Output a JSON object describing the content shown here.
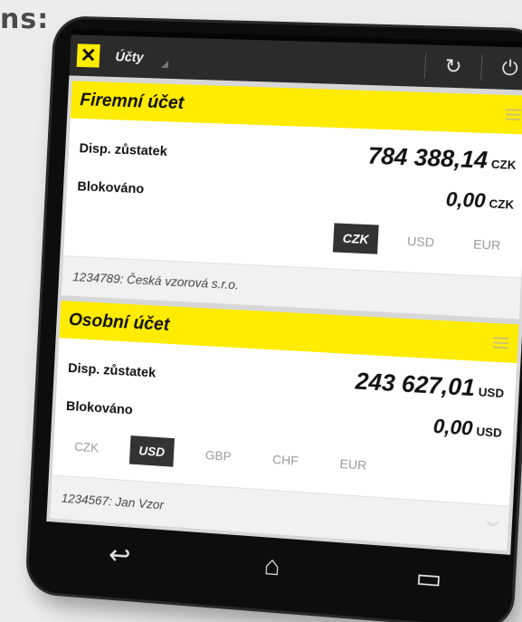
{
  "corner_text": "ns:",
  "app": {
    "title": "Účty"
  },
  "icons": {
    "logo": "raiffeisen-x-logo",
    "refresh": "refresh-icon",
    "power": "power-icon",
    "menu": "menu-icon"
  },
  "colors": {
    "accent": "#ffec00",
    "appbar": "#2b2b2b",
    "active_tab": "#333333"
  },
  "accounts": [
    {
      "title": "Firemní účet",
      "balance_label": "Disp. zůstatek",
      "balance": "784 388,14",
      "balance_currency": "CZK",
      "blocked_label": "Blokováno",
      "blocked": "0,00",
      "blocked_currency": "CZK",
      "currencies": [
        "CZK",
        "USD",
        "EUR"
      ],
      "selected_currency": "CZK",
      "footer": "1234789: Česká vzorová s.r.o."
    },
    {
      "title": "Osobní účet",
      "balance_label": "Disp. zůstatek",
      "balance": "243 627,01",
      "balance_currency": "USD",
      "blocked_label": "Blokováno",
      "blocked": "0,00",
      "blocked_currency": "USD",
      "currencies": [
        "CZK",
        "USD",
        "GBP",
        "CHF",
        "EUR"
      ],
      "selected_currency": "USD",
      "footer": "1234567: Jan Vzor"
    }
  ],
  "nav": {
    "back": "back-icon",
    "home": "home-icon",
    "recents": "recents-icon"
  }
}
